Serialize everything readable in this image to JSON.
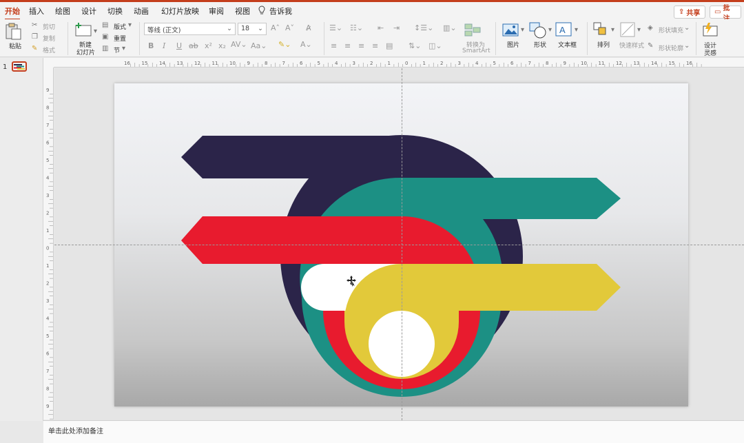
{
  "tabs": [
    "开始",
    "插入",
    "绘图",
    "设计",
    "切换",
    "动画",
    "幻灯片放映",
    "审阅",
    "视图"
  ],
  "tell_me": "告诉我",
  "share": "共享",
  "comment": "批注",
  "clipboard": {
    "paste": "粘贴",
    "cut": "剪切",
    "copy": "复制",
    "format": "格式"
  },
  "slides": {
    "new_line1": "新建",
    "new_line2": "幻灯片",
    "layout": "版式",
    "reset": "重置",
    "section": "节"
  },
  "font": {
    "name": "等线 (正文)",
    "size": "18"
  },
  "drawing": {
    "convert_line1": "转换为",
    "convert_line2": "SmartArt",
    "picture": "图片",
    "shape": "形状",
    "textbox": "文本框",
    "arrange": "排列",
    "quick_styles": "快速样式",
    "shape_fill": "形状填充",
    "shape_outline": "形状轮廓",
    "design_line1": "设计",
    "design_line2": "灵感"
  },
  "thumbnail_number": "1",
  "notes_placeholder": "单击此处添加备注",
  "ruler_h_labels": [
    "16",
    "15",
    "14",
    "13",
    "12",
    "11",
    "10",
    "9",
    "8",
    "7",
    "6",
    "5",
    "4",
    "3",
    "2",
    "1",
    "0",
    "1",
    "2",
    "3",
    "4",
    "5",
    "6",
    "7",
    "8",
    "9",
    "10",
    "11",
    "12",
    "13",
    "14",
    "15",
    "16"
  ],
  "ruler_v_labels": [
    "9",
    "8",
    "7",
    "6",
    "5",
    "4",
    "3",
    "2",
    "1",
    "0",
    "1",
    "2",
    "3",
    "4",
    "5",
    "6",
    "7",
    "8",
    "9"
  ],
  "colors": {
    "accent": "#c43e1c",
    "navy": "#2b2449",
    "teal": "#1c9084",
    "red": "#e81b2e",
    "yellow": "#e2c93a",
    "white": "#ffffff"
  }
}
